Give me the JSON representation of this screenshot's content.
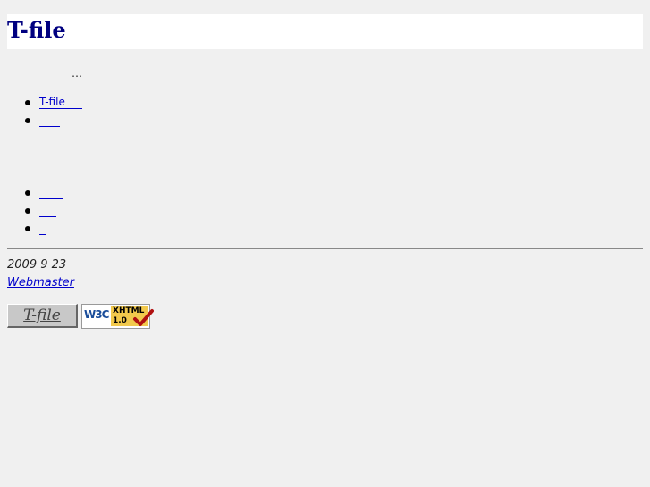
{
  "header": {
    "title": "T-file"
  },
  "intro": {
    "ellipsis": "…"
  },
  "nav_top": {
    "items": [
      {
        "label": "T-file"
      },
      {
        "label": ""
      }
    ]
  },
  "nav_bottom": {
    "items": [
      {
        "label": ""
      },
      {
        "label": ""
      },
      {
        "label": ""
      }
    ]
  },
  "footer": {
    "date": "2009  9  23",
    "webmaster": "Webmaster",
    "badge_tfile": "T-file",
    "badge_w3c": "W3C",
    "badge_xhtml": "XHTML",
    "badge_xhtml_version": "1.0"
  },
  "colors": {
    "title": "#000080",
    "link": "#0000cc",
    "background": "#f0f0f0"
  }
}
